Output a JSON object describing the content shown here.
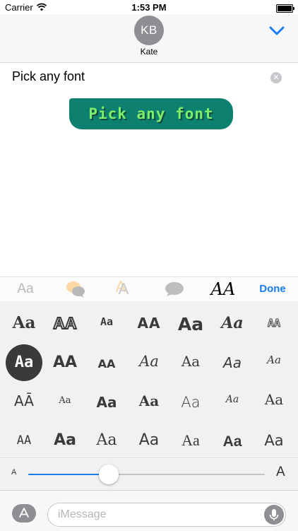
{
  "status_bar": {
    "carrier": "Carrier",
    "time": "1:53 PM"
  },
  "header": {
    "avatar_initials": "KB",
    "contact_name": "Kate",
    "collapse_icon": "chevron-down-icon"
  },
  "compose": {
    "text": "Pick any font",
    "clear_icon": "clear-icon"
  },
  "sticker": {
    "text": "Pick any font",
    "background": "#0d8070",
    "text_color": "#7cf06a"
  },
  "toolbar": {
    "aa_label": "Aa",
    "style_label": "AA",
    "done_label": "Done",
    "accent": "#1a7cf2"
  },
  "font_grid": {
    "rows": [
      [
        "Aa",
        "AA",
        "Aa",
        "AA",
        "Aa",
        "Aa",
        "AA"
      ],
      [
        "Aa",
        "AA",
        "AA",
        "Aa",
        "Aa",
        "Aa",
        "Aa"
      ],
      [
        "AĀ",
        "Aa",
        "Aa",
        "Aa",
        "Aa",
        "Aa",
        "Aa"
      ],
      [
        "AA",
        "Aa",
        "Aa",
        "Aa",
        "Aa",
        "Aa",
        "Aa"
      ]
    ],
    "selected_label": "Aa"
  },
  "size_slider": {
    "min_label": "A",
    "max_label": "A",
    "value": 0.34
  },
  "input": {
    "placeholder": "iMessage",
    "app_icon": "app-store-icon",
    "mic_icon": "microphone-icon"
  }
}
